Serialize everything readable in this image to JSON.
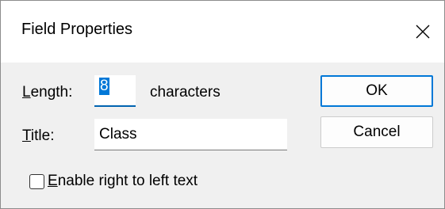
{
  "dialog": {
    "title": "Field Properties",
    "close_glyph": "✕"
  },
  "fields": {
    "length_label_accel": "L",
    "length_label_rest": "ength:",
    "length_value": "8",
    "length_suffix": "characters",
    "title_label_accel": "T",
    "title_label_rest": "itle:",
    "title_value": "Class"
  },
  "buttons": {
    "ok_label": "OK",
    "cancel_label": "Cancel"
  },
  "options": {
    "rtl_accel": "E",
    "rtl_rest": "nable right to left text",
    "rtl_checked": false
  },
  "icons": {
    "close": "close-icon"
  },
  "colors": {
    "accent": "#0078d7",
    "window_bg": "#f0f0f0",
    "titlebar_bg": "#ffffff"
  }
}
